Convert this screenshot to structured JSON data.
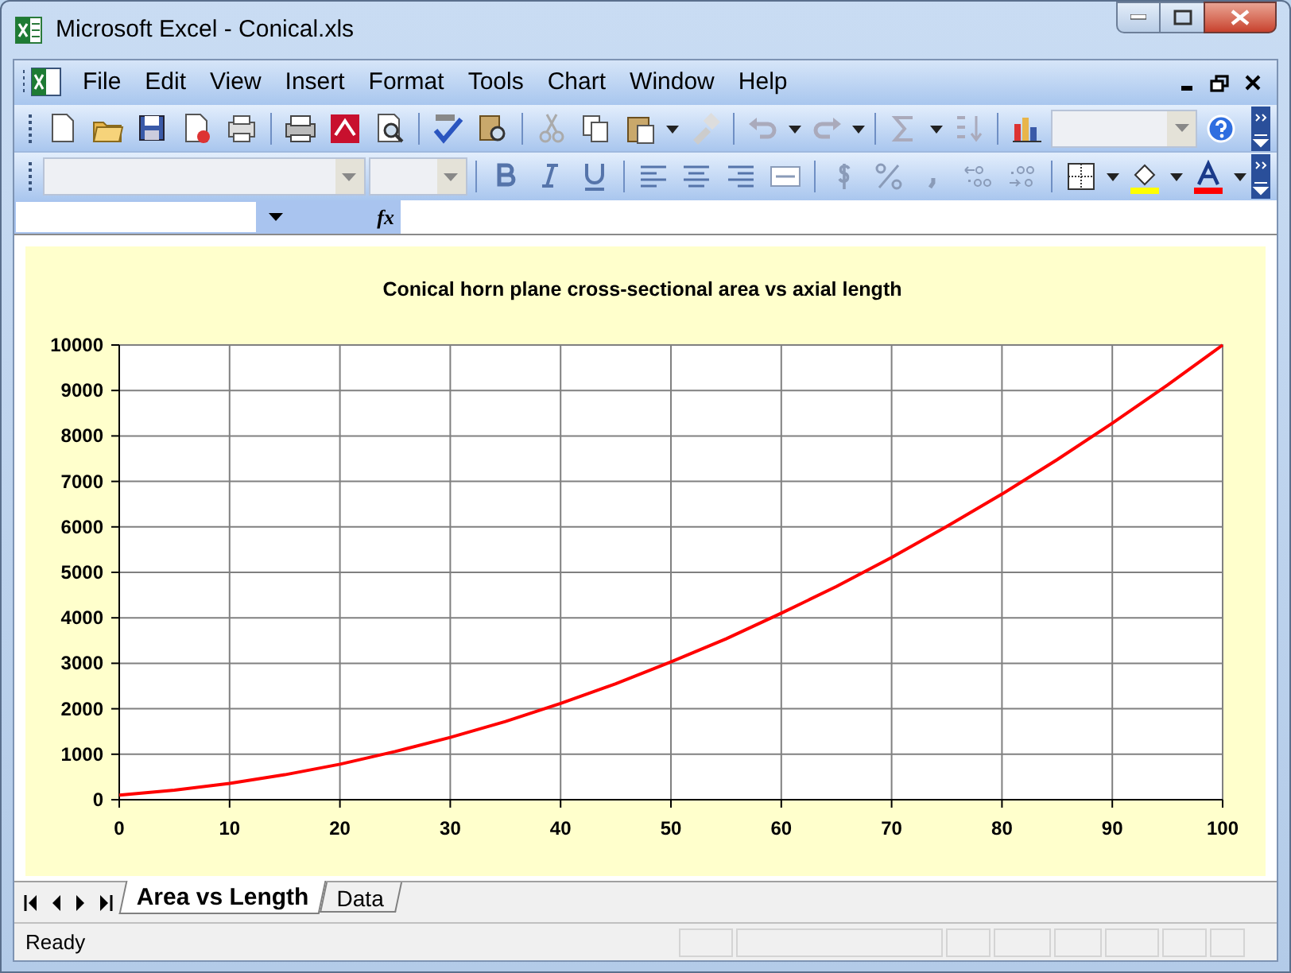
{
  "window": {
    "title": "Microsoft Excel - Conical.xls"
  },
  "menu": [
    "File",
    "Edit",
    "View",
    "Insert",
    "Format",
    "Tools",
    "Chart",
    "Window",
    "Help"
  ],
  "formula_bar": {
    "function_label": "fx"
  },
  "chart": {
    "chart_data": {
      "type": "line",
      "title": "Conical horn plane cross-sectional area vs axial length",
      "x": [
        0,
        5,
        10,
        15,
        20,
        25,
        30,
        35,
        40,
        45,
        50,
        55,
        60,
        65,
        70,
        75,
        80,
        85,
        90,
        95,
        100
      ],
      "series": [
        {
          "color": "#ff0000",
          "values": [
            100,
            210,
            360,
            550,
            780,
            1060,
            1370,
            1720,
            2120,
            2550,
            3030,
            3540,
            4100,
            4690,
            5330,
            6010,
            6720,
            7480,
            8280,
            9120,
            10000
          ]
        }
      ],
      "grid": true,
      "xlim": [
        0,
        100
      ],
      "ylim": [
        0,
        10000
      ],
      "xticks": [
        0,
        10,
        20,
        30,
        40,
        50,
        60,
        70,
        80,
        90,
        100
      ],
      "yticks": [
        0,
        1000,
        2000,
        3000,
        4000,
        5000,
        6000,
        7000,
        8000,
        9000,
        10000
      ]
    }
  },
  "sheet_tabs": [
    {
      "label": "Area vs Length",
      "selected": true
    },
    {
      "label": "Data",
      "selected": false
    }
  ],
  "status_bar": {
    "text": "Ready"
  }
}
